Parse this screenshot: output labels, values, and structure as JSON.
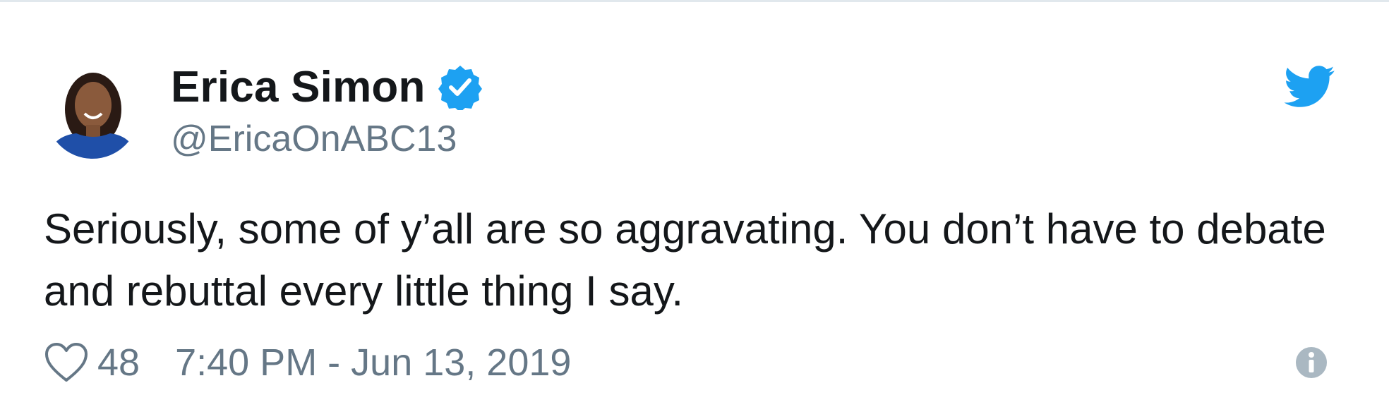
{
  "author": {
    "display_name": "Erica Simon",
    "handle": "@EricaOnABC13",
    "verified": true
  },
  "tweet": {
    "text": "Seriously, some of y’all are so aggravating. You don’t have to debate and rebuttal every little thing I say.",
    "like_count": "48",
    "timestamp": "7:40 PM - Jun 13, 2019"
  },
  "icons": {
    "verified": "verified-badge-icon",
    "brand": "twitter-bird-icon",
    "like": "heart-icon",
    "info": "info-icon"
  },
  "colors": {
    "brand_blue": "#1da1f2",
    "text_primary": "#14171a",
    "text_secondary": "#657786",
    "border": "#e1e8ed"
  }
}
